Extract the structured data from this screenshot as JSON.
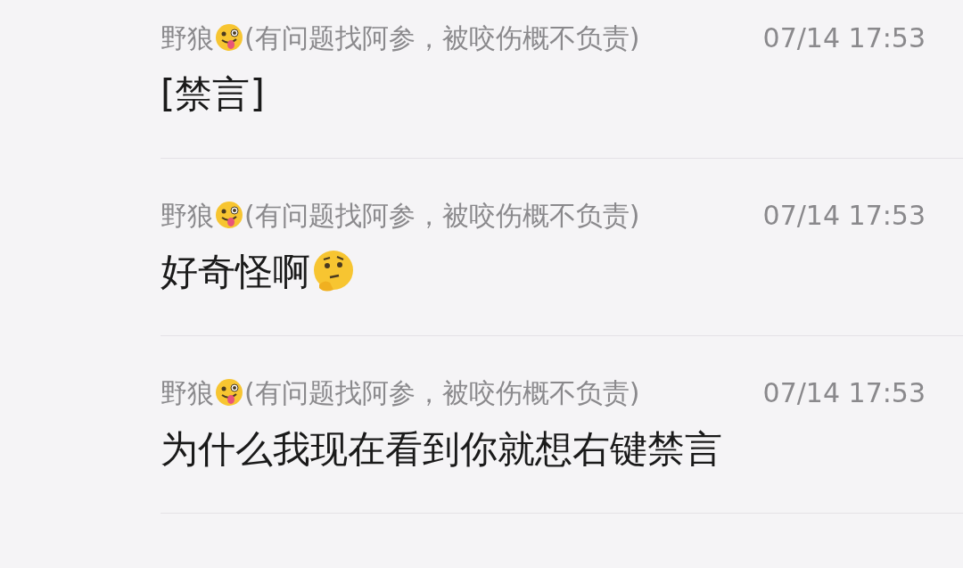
{
  "messages": [
    {
      "sender": "野狼",
      "sender_emoji": true,
      "remark": "(有问题找阿参，被咬伤概不负责)",
      "time": "07/14 17:53",
      "text": "[禁言]",
      "trailing_emoji": false
    },
    {
      "sender": "野狼",
      "sender_emoji": true,
      "remark": "(有问题找阿参，被咬伤概不负责)",
      "time": "07/14 17:53",
      "text": "好奇怪啊",
      "trailing_emoji": true
    },
    {
      "sender": "野狼",
      "sender_emoji": true,
      "remark": "(有问题找阿参，被咬伤概不负责)",
      "time": "07/14 17:53",
      "text": "为什么我现在看到你就想右键禁言",
      "trailing_emoji": false
    }
  ]
}
